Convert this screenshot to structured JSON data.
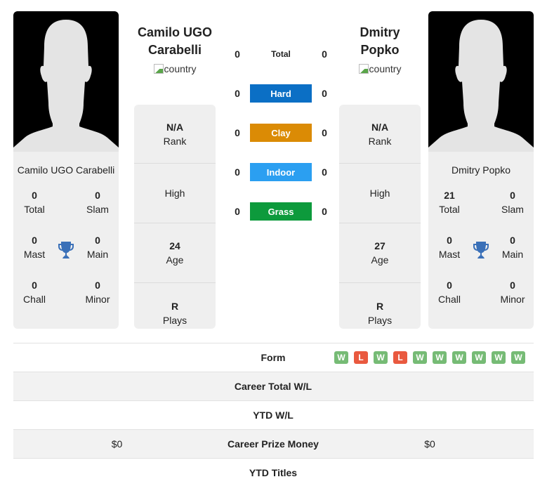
{
  "colors": {
    "hard": "#0b6fc5",
    "clay": "#db8b05",
    "indoor": "#2b9ff1",
    "grass": "#0d9a3c",
    "win": "#76bb75",
    "loss": "#e9593f",
    "trophy": "#3a70b8"
  },
  "player1": {
    "name": "Camilo UGO Carabelli",
    "name_line1": "Camilo UGO",
    "name_line2": "Carabelli",
    "country_alt": "country",
    "titles": {
      "total": "0",
      "total_label": "Total",
      "slam": "0",
      "slam_label": "Slam",
      "mast": "0",
      "mast_label": "Mast",
      "main": "0",
      "main_label": "Main",
      "chall": "0",
      "chall_label": "Chall",
      "minor": "0",
      "minor_label": "Minor"
    },
    "info": {
      "rank": "N/A",
      "rank_label": "Rank",
      "high": "High",
      "age": "24",
      "age_label": "Age",
      "plays": "R",
      "plays_label": "Plays"
    }
  },
  "player2": {
    "name": "Dmitry Popko",
    "name_line1": "Dmitry",
    "name_line2": "Popko",
    "country_alt": "country",
    "titles": {
      "total": "21",
      "total_label": "Total",
      "slam": "0",
      "slam_label": "Slam",
      "mast": "0",
      "mast_label": "Mast",
      "main": "0",
      "main_label": "Main",
      "chall": "0",
      "chall_label": "Chall",
      "minor": "0",
      "minor_label": "Minor"
    },
    "info": {
      "rank": "N/A",
      "rank_label": "Rank",
      "high": "High",
      "age": "27",
      "age_label": "Age",
      "plays": "R",
      "plays_label": "Plays"
    }
  },
  "h2h": [
    {
      "label": "Total",
      "p1": "0",
      "p2": "0"
    },
    {
      "label": "Hard",
      "p1": "0",
      "p2": "0"
    },
    {
      "label": "Clay",
      "p1": "0",
      "p2": "0"
    },
    {
      "label": "Indoor",
      "p1": "0",
      "p2": "0"
    },
    {
      "label": "Grass",
      "p1": "0",
      "p2": "0"
    }
  ],
  "stats": {
    "form_label": "Form",
    "form_p2": [
      "W",
      "L",
      "W",
      "L",
      "W",
      "W",
      "W",
      "W",
      "W",
      "W"
    ],
    "career_wl_label": "Career Total W/L",
    "ytd_wl_label": "YTD W/L",
    "prize_label": "Career Prize Money",
    "prize_p1": "$0",
    "prize_p2": "$0",
    "ytd_titles_label": "YTD Titles"
  }
}
